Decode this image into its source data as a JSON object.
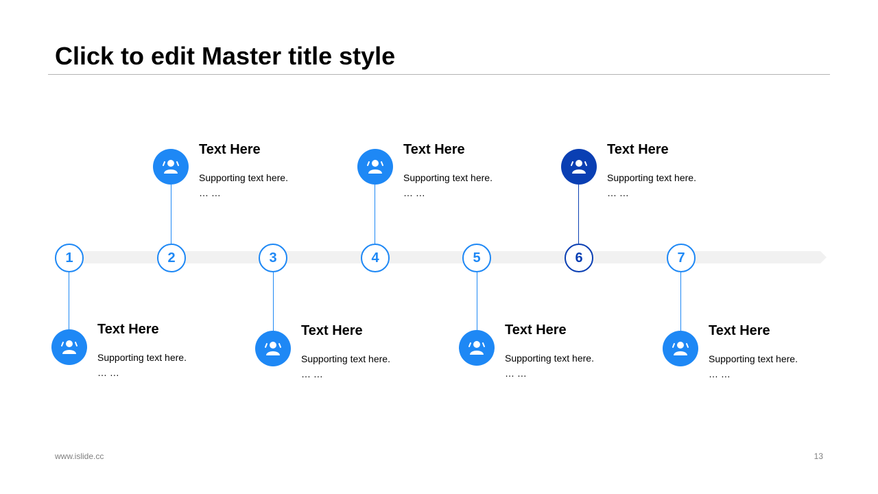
{
  "slide": {
    "title": "Click to edit Master title style",
    "footer_url": "www.islide.cc",
    "page_number": "13"
  },
  "timeline": {
    "nodes": [
      {
        "number": "1",
        "color": "#1e88f5"
      },
      {
        "number": "2",
        "color": "#1e88f5"
      },
      {
        "number": "3",
        "color": "#1e88f5"
      },
      {
        "number": "4",
        "color": "#1e88f5"
      },
      {
        "number": "5",
        "color": "#1e88f5"
      },
      {
        "number": "6",
        "color": "#0a3fb3"
      },
      {
        "number": "7",
        "color": "#1e88f5"
      }
    ],
    "cards": [
      {
        "heading": "Text Here",
        "body": "Supporting text here.",
        "ellipsis": "… …",
        "icon": "user-group-icon"
      },
      {
        "heading": "Text Here",
        "body": "Supporting text here.",
        "ellipsis": "… …",
        "icon": "user-group-icon"
      },
      {
        "heading": "Text Here",
        "body": "Supporting text here.",
        "ellipsis": "… …",
        "icon": "user-group-icon"
      },
      {
        "heading": "Text Here",
        "body": "Supporting text here.",
        "ellipsis": "… …",
        "icon": "user-group-icon"
      },
      {
        "heading": "Text Here",
        "body": "Supporting text here.",
        "ellipsis": "… …",
        "icon": "user-group-icon"
      },
      {
        "heading": "Text Here",
        "body": "Supporting text here.",
        "ellipsis": "… …",
        "icon": "user-group-icon"
      },
      {
        "heading": "Text Here",
        "body": "Supporting text here.",
        "ellipsis": "… …",
        "icon": "user-group-icon"
      }
    ]
  },
  "colors": {
    "accent": "#1e88f5",
    "highlight": "#0a3fb3",
    "track": "#f1f1f1"
  }
}
